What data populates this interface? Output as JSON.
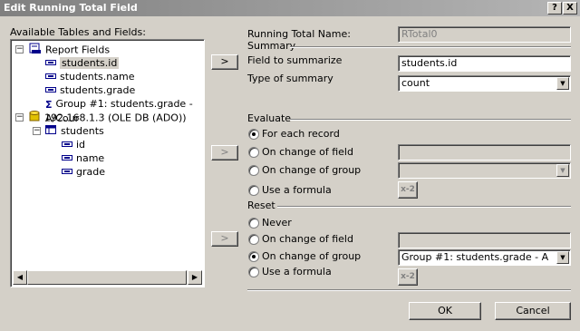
{
  "window": {
    "title": "Edit Running Total Field",
    "help_glyph": "?",
    "close_glyph": "X"
  },
  "left": {
    "available_label": "Available Tables and Fields:",
    "tree": [
      {
        "label": "Report Fields",
        "icon": "report-fields-icon",
        "expander": "−"
      },
      {
        "label": "students.id",
        "icon": "field-icon",
        "selected": true
      },
      {
        "label": "students.name",
        "icon": "field-icon"
      },
      {
        "label": "students.grade",
        "icon": "field-icon"
      },
      {
        "label": "Group #1: students.grade - A/Cour",
        "icon": "sigma-icon"
      },
      {
        "label": "192.168.1.3 (OLE DB (ADO))",
        "icon": "database-icon",
        "expander": "−"
      },
      {
        "label": "students",
        "icon": "table-icon",
        "expander": "−"
      },
      {
        "label": "id",
        "icon": "field-icon"
      },
      {
        "label": "name",
        "icon": "field-icon"
      },
      {
        "label": "grade",
        "icon": "field-icon"
      }
    ]
  },
  "arrow_glyph": ">",
  "right": {
    "rt_name_label": "Running Total Name:",
    "rt_name_value": "RTotal0",
    "summary_header": "Summary",
    "field_to_summarize_label": "Field to summarize",
    "field_to_summarize_value": "students.id",
    "type_of_summary_label": "Type of summary",
    "type_of_summary_value": "count",
    "evaluate_header": "Evaluate",
    "evaluate_options": [
      {
        "label": "For each record",
        "checked": true
      },
      {
        "label": "On change of field",
        "checked": false
      },
      {
        "label": "On change of group",
        "checked": false
      },
      {
        "label": "Use a formula",
        "checked": false
      }
    ],
    "reset_header": "Reset",
    "reset_options": [
      {
        "label": "Never",
        "checked": false
      },
      {
        "label": "On change of field",
        "checked": false
      },
      {
        "label": "On change of group",
        "checked": true
      },
      {
        "label": "Use a formula",
        "checked": false
      }
    ],
    "reset_group_value": "Group #1: students.grade - A",
    "formula_btn_glyph": "x-2"
  },
  "footer": {
    "ok_label": "OK",
    "cancel_label": "Cancel"
  }
}
